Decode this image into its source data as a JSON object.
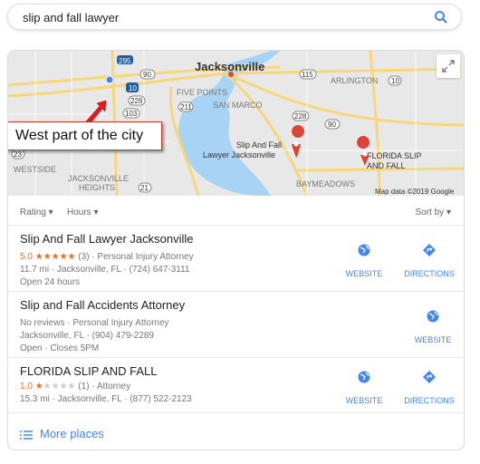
{
  "search": {
    "query": "slip and fall lawyer",
    "icon": "search-icon"
  },
  "map": {
    "labels": {
      "city": "Jacksonville",
      "five_points": "FIVE POINTS",
      "san_marco": "SAN MARCO",
      "arlington": "ARLINGTON",
      "westside": "WESTSIDE",
      "jax_heights_1": "JACKSONVILLE",
      "jax_heights_2": "HEIGHTS",
      "baymeadows": "BAYMEADOWS",
      "pin1_1": "Slip And Fall",
      "pin1_2": "Lawyer Jacksonville",
      "pin2_1": "FLORIDA SLIP",
      "pin2_2": "AND FALL"
    },
    "shields": [
      "295",
      "90",
      "10",
      "228",
      "103",
      "211",
      "115",
      "10",
      "228",
      "90",
      "23",
      "21"
    ],
    "attribution": "Map data ©2019 Google",
    "callout": "West part of the city",
    "colors": {
      "land": "#e8e8e8",
      "water": "#a9d3f5",
      "road": "#f8d77a",
      "pin": "#db4437",
      "callout_border": "#cc3333"
    }
  },
  "filters": {
    "rating": "Rating",
    "hours": "Hours",
    "sort": "Sort by"
  },
  "results": [
    {
      "name": "Slip And Fall Lawyer Jacksonville",
      "rating": "5.0",
      "stars": 5,
      "reviews": "(3)",
      "category": "Personal Injury Attorney",
      "line2": "11.7 mi · Jacksonville, FL · (724) 647-3111",
      "line3": "Open 24 hours",
      "website": "WEBSITE",
      "directions": "DIRECTIONS"
    },
    {
      "name": "Slip and Fall Accidents Attorney",
      "reviews_text": "No reviews",
      "category": "Personal Injury Attorney",
      "line2": "Jacksonville, FL · (904) 479-2289",
      "line3": "Open · Closes 5PM",
      "website": "WEBSITE"
    },
    {
      "name": "FLORIDA SLIP AND FALL",
      "rating": "1.0",
      "stars": 1,
      "reviews": "(1)",
      "category": "Attorney",
      "line2": "15.3 mi · Jacksonville, FL · (877) 522-2123",
      "website": "WEBSITE",
      "directions": "DIRECTIONS"
    }
  ],
  "more_places": "More places",
  "accent": "#4285f4"
}
